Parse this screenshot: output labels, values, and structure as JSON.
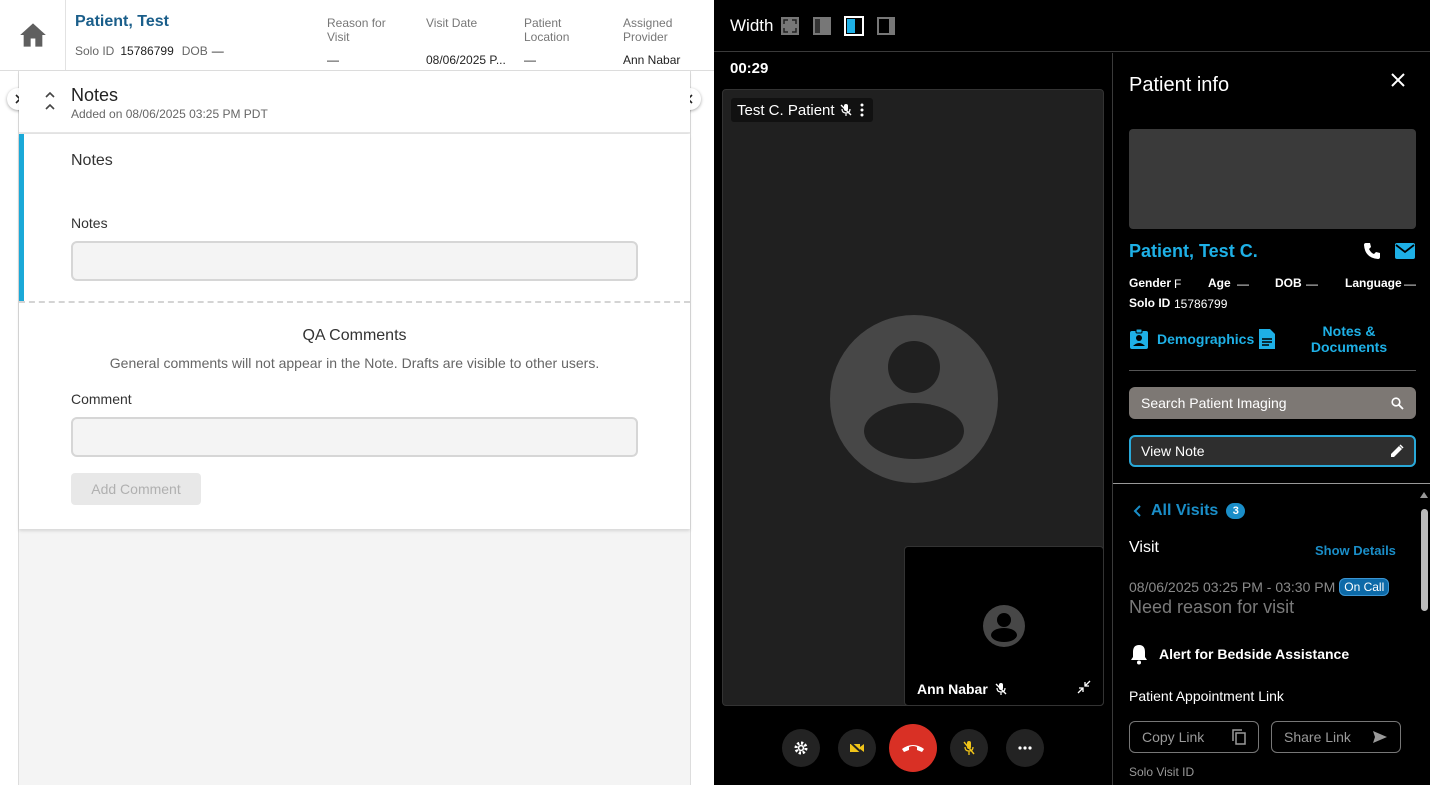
{
  "header": {
    "patient_name": "Patient, Test",
    "solo_id_label": "Solo ID",
    "solo_id_value": "15786799",
    "dob_label": "DOB",
    "dob_value": "—",
    "columns": [
      {
        "label": "Reason for Visit",
        "value": "—"
      },
      {
        "label": "Visit Date",
        "value": "08/06/2025 P..."
      },
      {
        "label": "Patient Location",
        "value": "—"
      },
      {
        "label": "Assigned Provider",
        "value": "Ann Nabar"
      }
    ]
  },
  "notes_panel": {
    "title": "Notes",
    "subtitle": "Added on 08/06/2025 03:25 PM PDT",
    "section_title": "Notes",
    "notes_label": "Notes",
    "notes_value": "",
    "qa_title": "QA Comments",
    "qa_subtitle": "General comments will not appear in the Note. Drafts are visible to other users.",
    "comment_label": "Comment",
    "comment_value": "",
    "add_comment_label": "Add Comment"
  },
  "video": {
    "width_label": "Width",
    "timer": "00:29",
    "remote_name": "Test C. Patient",
    "self_name": "Ann Nabar"
  },
  "patient_info": {
    "title": "Patient info",
    "name": "Patient, Test C.",
    "gender_label": "Gender",
    "gender_value": "F",
    "age_label": "Age",
    "age_value": "—",
    "dob_label": "DOB",
    "dob_value": "—",
    "language_label": "Language",
    "language_value": "—",
    "solo_id_label": "Solo ID",
    "solo_id_value": "15786799",
    "demographics_label": "Demographics",
    "notes_documents_label": "Notes & Documents",
    "search_imaging_label": "Search Patient Imaging",
    "view_note_label": "View Note"
  },
  "visits": {
    "all_visits_label": "All Visits",
    "count": "3",
    "visit_label": "Visit",
    "show_details_label": "Show Details",
    "time_range": "08/06/2025 03:25 PM - 03:30 PM",
    "status_badge": "On Call",
    "reason": "Need reason for visit",
    "alert_label": "Alert for Bedside Assistance",
    "appointment_link_label": "Patient Appointment Link",
    "copy_link_label": "Copy Link",
    "share_link_label": "Share Link",
    "solo_visit_id_label": "Solo Visit ID"
  },
  "colors": {
    "accent_blue": "#1eb0e6",
    "header_name": "#1a5e8a",
    "end_call_red": "#d93025",
    "status_badge": "#0d6aa8"
  }
}
